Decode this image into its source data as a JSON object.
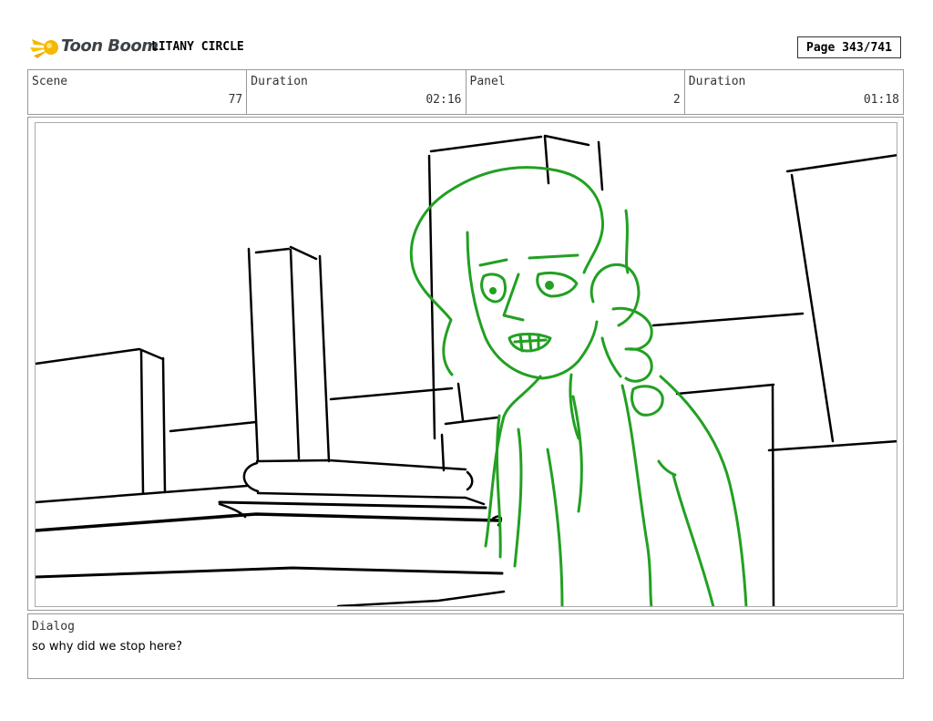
{
  "header": {
    "logo_text": "Toon Boom",
    "logo_icon": "comet-logo-icon",
    "project_title": "LITANY CIRCLE",
    "page_label": "Page 343/741"
  },
  "info": {
    "scene_label": "Scene",
    "scene_value": "77",
    "scene_duration_label": "Duration",
    "scene_duration_value": "02:16",
    "panel_label": "Panel",
    "panel_value": "2",
    "panel_duration_label": "Duration",
    "panel_duration_value": "01:18"
  },
  "dialog": {
    "label": "Dialog",
    "text": "so why did we stop here?"
  },
  "colors": {
    "character_line": "#22a022",
    "background_line": "#000000",
    "logo_accent": "#f5b800"
  }
}
